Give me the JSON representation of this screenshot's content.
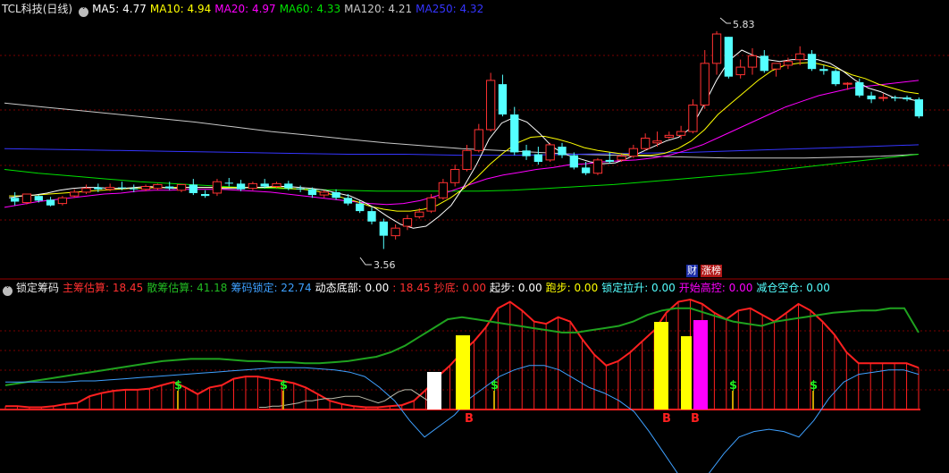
{
  "colors": {
    "up": "#ff3232",
    "down": "#54ffff",
    "grid": "#7a0000",
    "ma5": "#ffffff",
    "ma10": "#ffff00",
    "ma20": "#ff00ff",
    "ma60": "#00e000",
    "ma120": "#c8c8c8",
    "ma250": "#3535ff",
    "main": "#ff2020",
    "scatter": "#1fa21f",
    "lock": "#3ea0ff",
    "white": "#ffffff",
    "yellow": "#ffff00",
    "magenta": "#ff00ff",
    "dollar": "#22ee22"
  },
  "main_panel": {
    "title": "TCL科技(日线)",
    "ma_labels": [
      {
        "name": "MA5:",
        "value": "4.77",
        "color": "#ffffff"
      },
      {
        "name": "MA10:",
        "value": "4.94",
        "color": "#ffff00"
      },
      {
        "name": "MA20:",
        "value": "4.97",
        "color": "#ff00ff"
      },
      {
        "name": "MA60:",
        "value": "4.33",
        "color": "#00e000"
      },
      {
        "name": "MA120:",
        "value": "4.21",
        "color": "#c8c8c8"
      },
      {
        "name": "MA250:",
        "value": "4.32",
        "color": "#3535ff"
      }
    ],
    "high_label": "5.83",
    "low_label": "3.56",
    "badge_cai": "财",
    "badge_zhangbang": "涨榜"
  },
  "sub_panel": {
    "title": "锁定筹码",
    "labels": [
      {
        "name": "主筹估算:",
        "value": "18.45",
        "color": "#ff3030"
      },
      {
        "name": "散筹估算:",
        "value": "41.18",
        "color": "#22bb22"
      },
      {
        "name": "筹码锁定:",
        "value": "22.74",
        "color": "#3ea0ff"
      },
      {
        "name": "动态底部:",
        "value": "0.00",
        "color": "#ffffff"
      },
      {
        "name": ":",
        "value": "18.45",
        "color": "#ff3030"
      },
      {
        "name": "抄底:",
        "value": "0.00",
        "color": "#ff3030"
      },
      {
        "name": "起步:",
        "value": "0.00",
        "color": "#ffffff"
      },
      {
        "name": "跑步:",
        "value": "0.00",
        "color": "#ffff00"
      },
      {
        "name": "锁定拉升:",
        "value": "0.00",
        "color": "#54ffff"
      },
      {
        "name": "开始高控:",
        "value": "0.00",
        "color": "#ff00ff"
      },
      {
        "name": "减仓空仓:",
        "value": "0.00",
        "color": "#54ffff"
      }
    ],
    "buy_mark": "B",
    "sell_mark": "$"
  },
  "chart_data": {
    "type": "candlestick",
    "price_range": [
      3.3,
      6.0
    ],
    "indicator_range": [
      -5,
      100
    ],
    "candles": [
      [
        4.1,
        4.16,
        4.06,
        4.02
      ],
      [
        4.05,
        4.07,
        4.14,
        4.03
      ],
      [
        4.12,
        4.13,
        4.07,
        4.05
      ],
      [
        4.08,
        4.11,
        4.02,
        4.01
      ],
      [
        4.04,
        4.12,
        4.1,
        4.02
      ],
      [
        4.12,
        4.19,
        4.16,
        4.1
      ],
      [
        4.16,
        4.24,
        4.2,
        4.14
      ],
      [
        4.21,
        4.25,
        4.19,
        4.16
      ],
      [
        4.19,
        4.25,
        4.21,
        4.17
      ],
      [
        4.21,
        4.27,
        4.2,
        4.18
      ],
      [
        4.2,
        4.24,
        4.19,
        4.16
      ],
      [
        4.19,
        4.24,
        4.22,
        4.17
      ],
      [
        4.2,
        4.25,
        4.24,
        4.18
      ],
      [
        4.22,
        4.27,
        4.2,
        4.18
      ],
      [
        4.18,
        4.24,
        4.24,
        4.16
      ],
      [
        4.24,
        4.3,
        4.15,
        4.13
      ],
      [
        4.14,
        4.18,
        4.12,
        4.1
      ],
      [
        4.15,
        4.3,
        4.27,
        4.12
      ],
      [
        4.26,
        4.31,
        4.25,
        4.22
      ],
      [
        4.25,
        4.29,
        4.19,
        4.17
      ],
      [
        4.2,
        4.27,
        4.25,
        4.18
      ],
      [
        4.25,
        4.3,
        4.22,
        4.2
      ],
      [
        4.22,
        4.27,
        4.25,
        4.2
      ],
      [
        4.25,
        4.28,
        4.2,
        4.18
      ],
      [
        4.2,
        4.23,
        4.19,
        4.16
      ],
      [
        4.19,
        4.21,
        4.13,
        4.1
      ],
      [
        4.13,
        4.18,
        4.16,
        4.1
      ],
      [
        4.16,
        4.19,
        4.1,
        4.08
      ],
      [
        4.1,
        4.14,
        4.04,
        4.02
      ],
      [
        4.04,
        4.07,
        3.96,
        3.94
      ],
      [
        3.96,
        4.0,
        3.85,
        3.82
      ],
      [
        3.85,
        3.88,
        3.7,
        3.56
      ],
      [
        3.7,
        3.82,
        3.78,
        3.66
      ],
      [
        3.8,
        3.92,
        3.88,
        3.76
      ],
      [
        3.9,
        3.99,
        3.95,
        3.88
      ],
      [
        3.96,
        4.14,
        4.1,
        3.94
      ],
      [
        4.1,
        4.3,
        4.26,
        4.08
      ],
      [
        4.26,
        4.45,
        4.4,
        4.22
      ],
      [
        4.4,
        4.66,
        4.6,
        4.38
      ],
      [
        4.6,
        4.88,
        4.82,
        4.58
      ],
      [
        4.82,
        5.42,
        5.34,
        4.8
      ],
      [
        5.3,
        5.4,
        4.98,
        4.96
      ],
      [
        4.98,
        5.06,
        4.58,
        4.55
      ],
      [
        4.6,
        4.66,
        4.54,
        4.5
      ],
      [
        4.56,
        4.64,
        4.48,
        4.45
      ],
      [
        4.5,
        4.68,
        4.66,
        4.48
      ],
      [
        4.64,
        4.68,
        4.55,
        4.52
      ],
      [
        4.55,
        4.58,
        4.42,
        4.4
      ],
      [
        4.42,
        4.48,
        4.36,
        4.34
      ],
      [
        4.36,
        4.52,
        4.5,
        4.34
      ],
      [
        4.5,
        4.58,
        4.48,
        4.46
      ],
      [
        4.5,
        4.56,
        4.54,
        4.48
      ],
      [
        4.54,
        4.66,
        4.62,
        4.52
      ],
      [
        4.62,
        4.78,
        4.73,
        4.6
      ],
      [
        4.68,
        4.8,
        4.7,
        4.64
      ],
      [
        4.74,
        4.8,
        4.76,
        4.72
      ],
      [
        4.76,
        4.86,
        4.8,
        4.72
      ],
      [
        4.8,
        5.14,
        5.08,
        4.78
      ],
      [
        5.08,
        5.66,
        5.52,
        5.04
      ],
      [
        5.52,
        5.86,
        5.83,
        5.4
      ],
      [
        5.8,
        5.66,
        5.38,
        5.36
      ],
      [
        5.4,
        5.56,
        5.48,
        5.36
      ],
      [
        5.48,
        5.68,
        5.6,
        5.4
      ],
      [
        5.6,
        5.66,
        5.44,
        5.42
      ],
      [
        5.46,
        5.52,
        5.52,
        5.38
      ],
      [
        5.5,
        5.58,
        5.54,
        5.46
      ],
      [
        5.56,
        5.7,
        5.62,
        5.5
      ],
      [
        5.62,
        5.66,
        5.46,
        5.44
      ],
      [
        5.46,
        5.5,
        5.44,
        5.4
      ],
      [
        5.44,
        5.46,
        5.3,
        5.28
      ],
      [
        5.3,
        5.32,
        5.31,
        5.24
      ],
      [
        5.32,
        5.36,
        5.18,
        5.16
      ],
      [
        5.18,
        5.22,
        5.14,
        5.1
      ],
      [
        5.16,
        5.2,
        5.16,
        5.12
      ],
      [
        5.16,
        5.18,
        5.15,
        5.12
      ],
      [
        5.16,
        5.18,
        5.14,
        5.12
      ],
      [
        5.14,
        5.16,
        4.96,
        4.94
      ]
    ],
    "ma_lines": {
      "ma5": [
        4.1,
        4.12,
        4.13,
        4.15,
        4.18,
        4.2,
        4.21,
        4.21,
        4.2,
        4.2,
        4.21,
        4.22,
        4.21,
        4.2,
        4.21,
        4.21,
        4.21,
        4.2,
        4.2,
        4.21,
        4.21,
        4.22,
        4.22,
        4.21,
        4.2,
        4.18,
        4.15,
        4.12,
        4.06,
        3.99,
        3.9,
        3.82,
        3.78,
        3.8,
        3.9,
        4.02,
        4.22,
        4.45,
        4.72,
        4.89,
        4.95,
        4.9,
        4.78,
        4.64,
        4.56,
        4.52,
        4.48,
        4.46,
        4.47,
        4.52,
        4.58,
        4.64,
        4.7,
        4.74,
        4.84,
        5.08,
        5.34,
        5.55,
        5.66,
        5.6,
        5.56,
        5.54,
        5.56,
        5.56,
        5.56,
        5.52,
        5.44,
        5.34,
        5.26,
        5.22,
        5.16,
        5.15,
        5.12
      ],
      "ma10": [
        4.12,
        4.12,
        4.13,
        4.14,
        4.15,
        4.16,
        4.17,
        4.18,
        4.19,
        4.2,
        4.2,
        4.21,
        4.21,
        4.21,
        4.21,
        4.21,
        4.21,
        4.21,
        4.21,
        4.21,
        4.21,
        4.2,
        4.19,
        4.17,
        4.14,
        4.1,
        4.06,
        4.01,
        3.98,
        3.96,
        3.96,
        3.98,
        4.02,
        4.1,
        4.2,
        4.32,
        4.46,
        4.58,
        4.68,
        4.74,
        4.75,
        4.72,
        4.68,
        4.63,
        4.6,
        4.58,
        4.56,
        4.55,
        4.55,
        4.57,
        4.62,
        4.7,
        4.82,
        4.98,
        5.1,
        5.22,
        5.34,
        5.44,
        5.5,
        5.52,
        5.53,
        5.5,
        5.46,
        5.4,
        5.36,
        5.3,
        5.26,
        5.22,
        5.2
      ],
      "ma20": [
        4.0,
        4.03,
        4.06,
        4.08,
        4.1,
        4.12,
        4.14,
        4.15,
        4.17,
        4.18,
        4.18,
        4.19,
        4.19,
        4.19,
        4.18,
        4.17,
        4.16,
        4.14,
        4.12,
        4.1,
        4.08,
        4.06,
        4.04,
        4.03,
        4.04,
        4.07,
        4.12,
        4.18,
        4.24,
        4.3,
        4.34,
        4.37,
        4.4,
        4.42,
        4.45,
        4.46,
        4.48,
        4.49,
        4.5,
        4.52,
        4.55,
        4.6,
        4.66,
        4.74,
        4.82,
        4.9,
        4.98,
        5.06,
        5.12,
        5.18,
        5.22,
        5.26,
        5.28,
        5.3,
        5.32,
        5.34
      ],
      "ma60": [
        4.4,
        4.36,
        4.33,
        4.3,
        4.27,
        4.25,
        4.23,
        4.21,
        4.2,
        4.19,
        4.18,
        4.17,
        4.17,
        4.17,
        4.17,
        4.18,
        4.2,
        4.22,
        4.24,
        4.27,
        4.3,
        4.33,
        4.36,
        4.4,
        4.44,
        4.48,
        4.52,
        4.56
      ],
      "ma120": [
        5.1,
        5.06,
        5.02,
        4.98,
        4.94,
        4.9,
        4.85,
        4.8,
        4.76,
        4.72,
        4.68,
        4.65,
        4.62,
        4.6,
        4.58,
        4.56,
        4.55,
        4.54,
        4.53,
        4.52,
        4.52,
        4.52,
        4.53,
        4.54,
        4.56
      ],
      "ma250": [
        4.62,
        4.61,
        4.6,
        4.59,
        4.58,
        4.57,
        4.56,
        4.56,
        4.55,
        4.55,
        4.56,
        4.57,
        4.58,
        4.6,
        4.62,
        4.64,
        4.66
      ]
    },
    "indicator": {
      "main_hist": [
        3,
        3,
        2,
        2,
        3,
        5,
        6,
        12,
        15,
        17,
        18,
        18,
        19,
        22,
        25,
        20,
        14,
        20,
        22,
        28,
        30,
        30,
        28,
        26,
        24,
        20,
        14,
        8,
        5,
        3,
        2,
        2,
        3,
        4,
        8,
        18,
        30,
        40,
        52,
        62,
        75,
        92,
        98,
        90,
        80,
        78,
        84,
        80,
        64,
        50,
        40,
        44,
        52,
        62,
        72,
        88,
        98,
        100,
        96,
        88,
        82,
        90,
        92,
        86,
        80,
        88,
        96,
        90,
        80,
        68,
        52,
        42,
        42,
        42,
        42,
        42,
        38
      ],
      "scatter": [
        22,
        24,
        26,
        28,
        30,
        32,
        34,
        36,
        38,
        40,
        42,
        44,
        45,
        46,
        46,
        46,
        45,
        44,
        44,
        43,
        43,
        42,
        42,
        43,
        44,
        46,
        48,
        52,
        58,
        66,
        74,
        82,
        84,
        82,
        80,
        78,
        76,
        74,
        72,
        70,
        70,
        72,
        74,
        76,
        80,
        86,
        90,
        92,
        92,
        88,
        84,
        80,
        78,
        76,
        80,
        82,
        84,
        86,
        88,
        89,
        90,
        90,
        92,
        92,
        70
      ],
      "lock": [
        25,
        25,
        25,
        25,
        25,
        26,
        26,
        27,
        28,
        29,
        30,
        31,
        32,
        33,
        34,
        35,
        36,
        37,
        38,
        38,
        38,
        37,
        36,
        34,
        30,
        20,
        8,
        -10,
        -25,
        -15,
        -5,
        10,
        20,
        30,
        36,
        40,
        40,
        36,
        28,
        20,
        15,
        8,
        -2,
        -20,
        -40,
        -60,
        -65,
        -58,
        -40,
        -25,
        -20,
        -18,
        -20,
        -25,
        -10,
        10,
        25,
        32,
        34,
        36,
        36,
        32
      ],
      "white_line": [
        2,
        2,
        3,
        3,
        4,
        5,
        6,
        8,
        8,
        9,
        10,
        10,
        11,
        12,
        12,
        12,
        10,
        8,
        6,
        8,
        12,
        16,
        18,
        18,
        14,
        10,
        6,
        4
      ],
      "sell_indices": [
        13,
        21,
        38,
        62,
        68
      ],
      "buy_indices": [
        37,
        53,
        56
      ]
    }
  }
}
